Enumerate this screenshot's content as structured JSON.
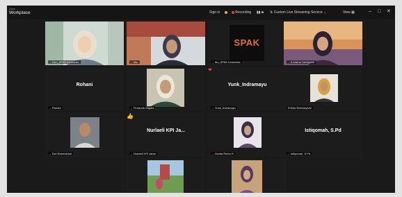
{
  "app": {
    "logo_small": "Zoom",
    "logo_title": "Workplace"
  },
  "topbar": {
    "sign_in": "Sign in",
    "recording": "Recording",
    "streaming": "Custom Live Streaming Service",
    "view": "View"
  },
  "icons": {
    "heart": "❤",
    "thumbs_up": "👍"
  },
  "colors": {
    "active_speaker_border": "#53c07a",
    "mic_muted": "#e0443e",
    "recording_dot": "#e0443e",
    "spak_orange": "#e8702a"
  },
  "tiles": [
    {
      "label": "Guu_SPAK Indonesia",
      "name": ""
    },
    {
      "label": "Ma-",
      "name": ""
    },
    {
      "label": "Ibu_SPAK Indonesia",
      "name": "",
      "logo_text": "SPAK"
    },
    {
      "label": "A.Dwina Herdiyanti",
      "name": ""
    },
    {
      "label": "Rohani",
      "name": "Rohani"
    },
    {
      "label": "Penanda Sagala",
      "name": ""
    },
    {
      "label": "Yunk_Indramayu",
      "name": "Yunk_Indramayu"
    },
    {
      "label": "Erisha Rahmayanti",
      "name": ""
    },
    {
      "label": "Dwi Rahmahtuti",
      "name": ""
    },
    {
      "label": "Nurlaeli KPI Jabar",
      "name": "Nurlaeli KPI Ja..."
    },
    {
      "label": "Novita Retno R",
      "name": ""
    },
    {
      "label": "Istiqomah, S.Pd",
      "name": "Istiqomah, S.Pd"
    },
    {
      "label": "",
      "name": ""
    },
    {
      "label": "",
      "name": ""
    }
  ]
}
